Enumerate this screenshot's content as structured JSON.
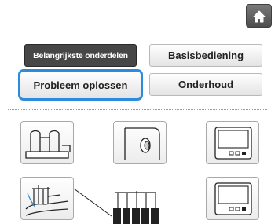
{
  "header": {
    "home_icon": "home-icon"
  },
  "categories": {
    "main_parts": "Belangrijkste onderdelen",
    "basic_operation": "Basisbediening",
    "troubleshooting": "Probleem oplossen",
    "maintenance": "Onderhoud"
  },
  "colors": {
    "selection_outline": "#2b8bdc",
    "active_tab": "#464646"
  },
  "tiles": [
    {
      "icon": "machine-front-icon"
    },
    {
      "icon": "handwheel-icon"
    },
    {
      "icon": "lcd-panel-icon"
    },
    {
      "icon": "thread-guide-icon"
    },
    {
      "icon": "spool-stand-icon"
    },
    {
      "icon": "lcd-panel-icon"
    }
  ]
}
